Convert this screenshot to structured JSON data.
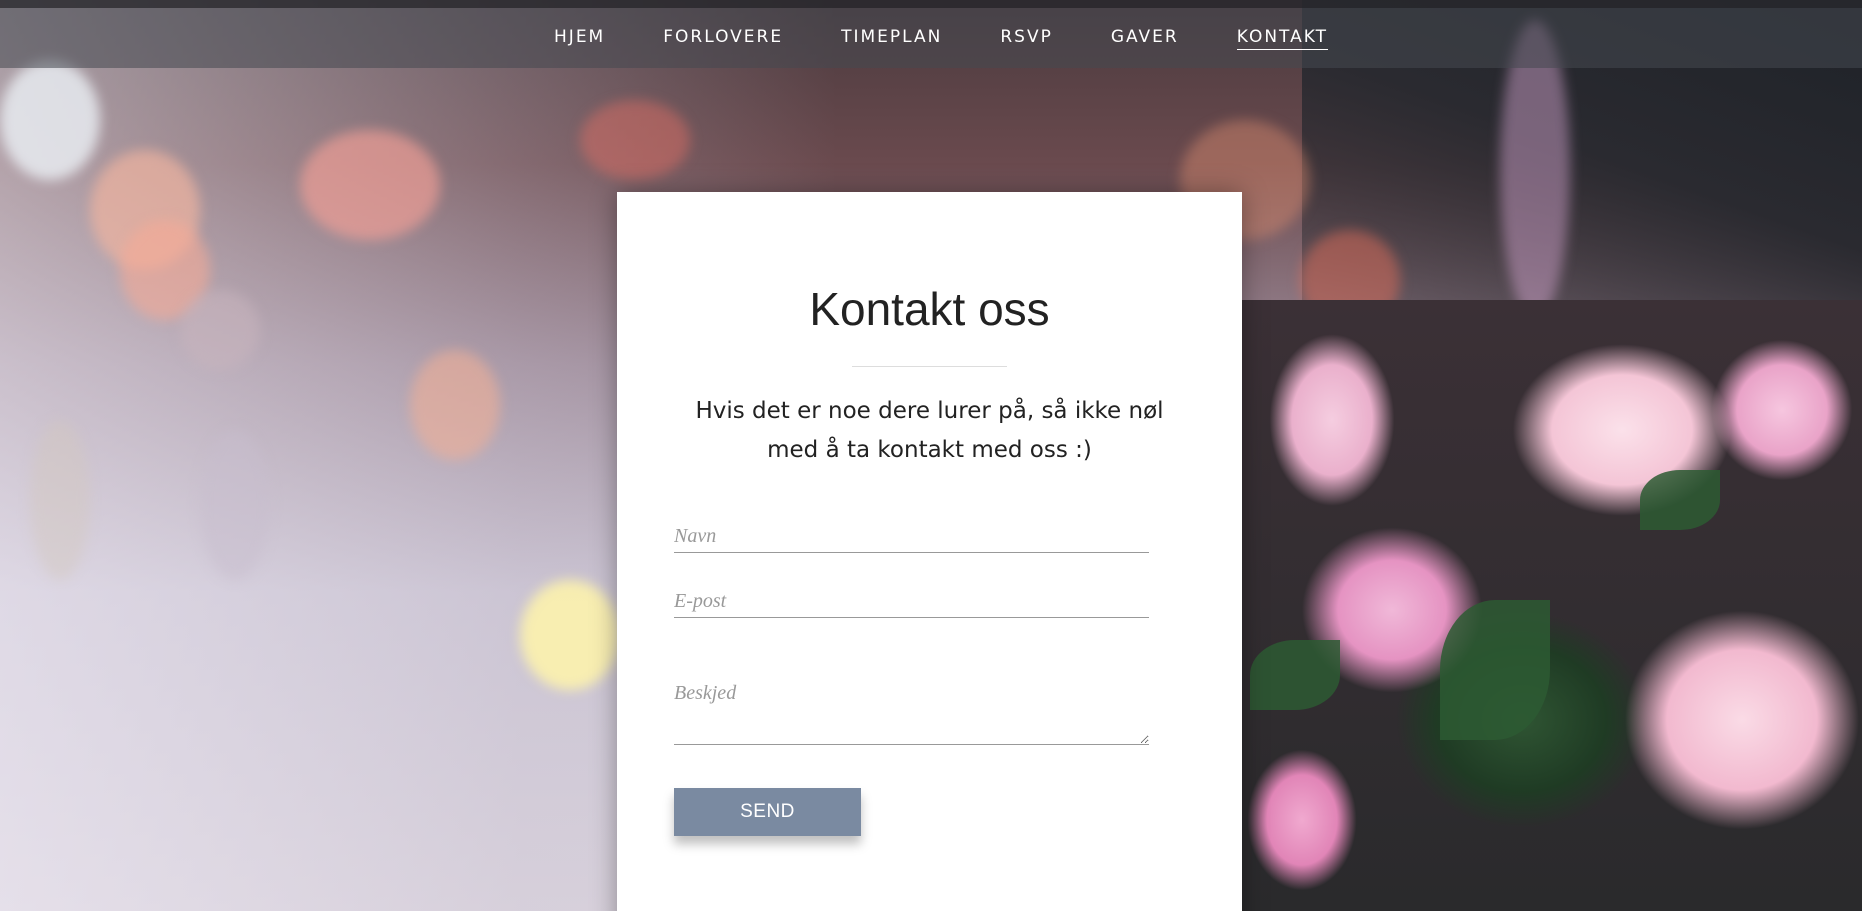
{
  "nav": {
    "items": [
      {
        "label": "HJEM",
        "active": false
      },
      {
        "label": "FORLOVERE",
        "active": false
      },
      {
        "label": "TIMEPLAN",
        "active": false
      },
      {
        "label": "RSVP",
        "active": false
      },
      {
        "label": "GAVER",
        "active": false
      },
      {
        "label": "KONTAKT",
        "active": true
      }
    ]
  },
  "contact": {
    "title": "Kontakt oss",
    "intro": "Hvis det er noe dere lurer på, så ikke nøl med å ta kontakt med oss :)",
    "form": {
      "name_placeholder": "Navn",
      "name_value": "",
      "email_placeholder": "E-post",
      "email_value": "",
      "message_placeholder": "Beskjed",
      "message_value": "",
      "send_label": "SEND"
    }
  },
  "colors": {
    "button_bg": "#7a8aa1",
    "nav_text": "#ffffff",
    "card_bg": "#ffffff",
    "heading_text": "#222222"
  },
  "background": {
    "description": "blurred bokeh lights with pink roses on the right"
  }
}
